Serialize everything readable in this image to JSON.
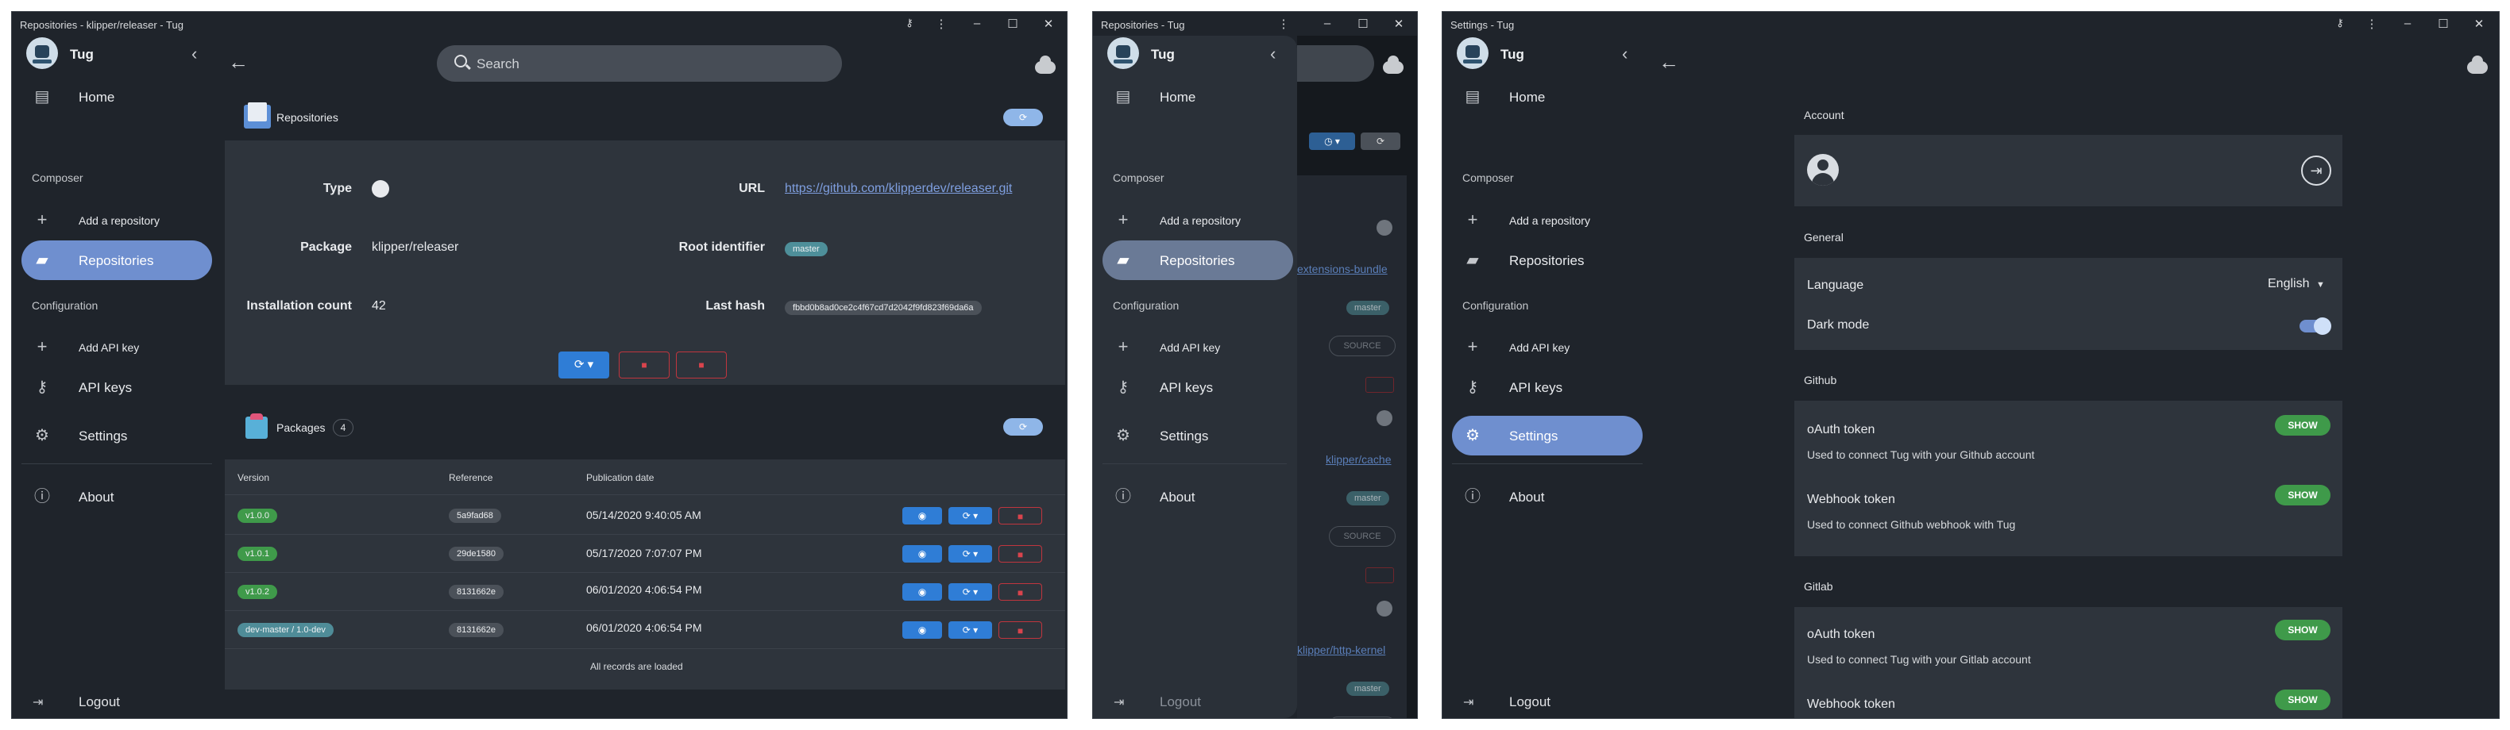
{
  "window1": {
    "title": "Repositories - klipper/releaser - Tug",
    "search_placeholder": "Search",
    "repositories_heading": "Repositories",
    "fields": {
      "type_label": "Type",
      "package_label": "Package",
      "package_value": "klipper/releaser",
      "installation_label": "Installation count",
      "installation_value": "42",
      "url_label": "URL",
      "url_value": "https://github.com/klipperdev/releaser.git",
      "root_label": "Root identifier",
      "root_value": "master",
      "hash_label": "Last hash",
      "hash_value": "fbbd0b8ad0ce2c4f67cd7d2042f9fd823f69da6a"
    },
    "packages_heading": "Packages",
    "packages_count": "4",
    "columns": [
      "Version",
      "Reference",
      "Publication date"
    ],
    "rows": [
      {
        "version": "v1.0.0",
        "reference": "5a9fad68",
        "date": "05/14/2020 9:40:05 AM"
      },
      {
        "version": "v1.0.1",
        "reference": "29de1580",
        "date": "05/17/2020 7:07:07 PM"
      },
      {
        "version": "v1.0.2",
        "reference": "8131662e",
        "date": "06/01/2020 4:06:54 PM"
      },
      {
        "version": "dev-master / 1.0-dev",
        "reference": "8131662e",
        "date": "06/01/2020 4:06:54 PM"
      }
    ],
    "all_loaded": "All records are loaded"
  },
  "window2": {
    "title": "Repositories - Tug",
    "bg_links": [
      "extensions-bundle",
      "klipper/cache",
      "klipper/http-kernel"
    ],
    "bg_badge": "master",
    "bg_source": "SOURCE"
  },
  "window3": {
    "title": "Settings - Tug",
    "account_heading": "Account",
    "general_heading": "General",
    "language_label": "Language",
    "language_value": "English",
    "darkmode_label": "Dark mode",
    "darkmode_on": true,
    "github_heading": "Github",
    "gh_oauth_label": "oAuth token",
    "gh_oauth_desc": "Used to connect Tug with your Github account",
    "gh_webhook_label": "Webhook token",
    "gh_webhook_desc": "Used to connect Github webhook with Tug",
    "gitlab_heading": "Gitlab",
    "gl_oauth_label": "oAuth token",
    "gl_oauth_desc": "Used to connect Tug with your Gitlab account",
    "gl_webhook_label": "Webhook token",
    "show_label": "SHOW"
  },
  "sidebar": {
    "brand": "Tug",
    "home": "Home",
    "composer_section": "Composer",
    "add_repository": "Add a repository",
    "repositories": "Repositories",
    "configuration_section": "Configuration",
    "add_api_key": "Add API key",
    "api_keys": "API keys",
    "settings": "Settings",
    "about": "About",
    "logout": "Logout"
  },
  "colors": {
    "background": "#1f242b",
    "card": "#2e343c",
    "active_nav": "#6f8fcf",
    "primary_button": "#2f7dd6",
    "danger": "#d9444d",
    "success_badge": "#3f9a4a",
    "link": "#7f9fe0"
  },
  "icons": [
    "key-icon",
    "kebab-menu-icon",
    "minimize-icon",
    "maximize-icon",
    "close-icon",
    "back-arrow-icon",
    "search-icon",
    "cloud-icon",
    "github-icon",
    "refresh-icon",
    "trash-icon",
    "eye-icon",
    "home-icon",
    "plus-icon",
    "folder-icon",
    "settings-icon",
    "info-icon",
    "logout-icon",
    "login-icon",
    "user-avatar-icon"
  ]
}
